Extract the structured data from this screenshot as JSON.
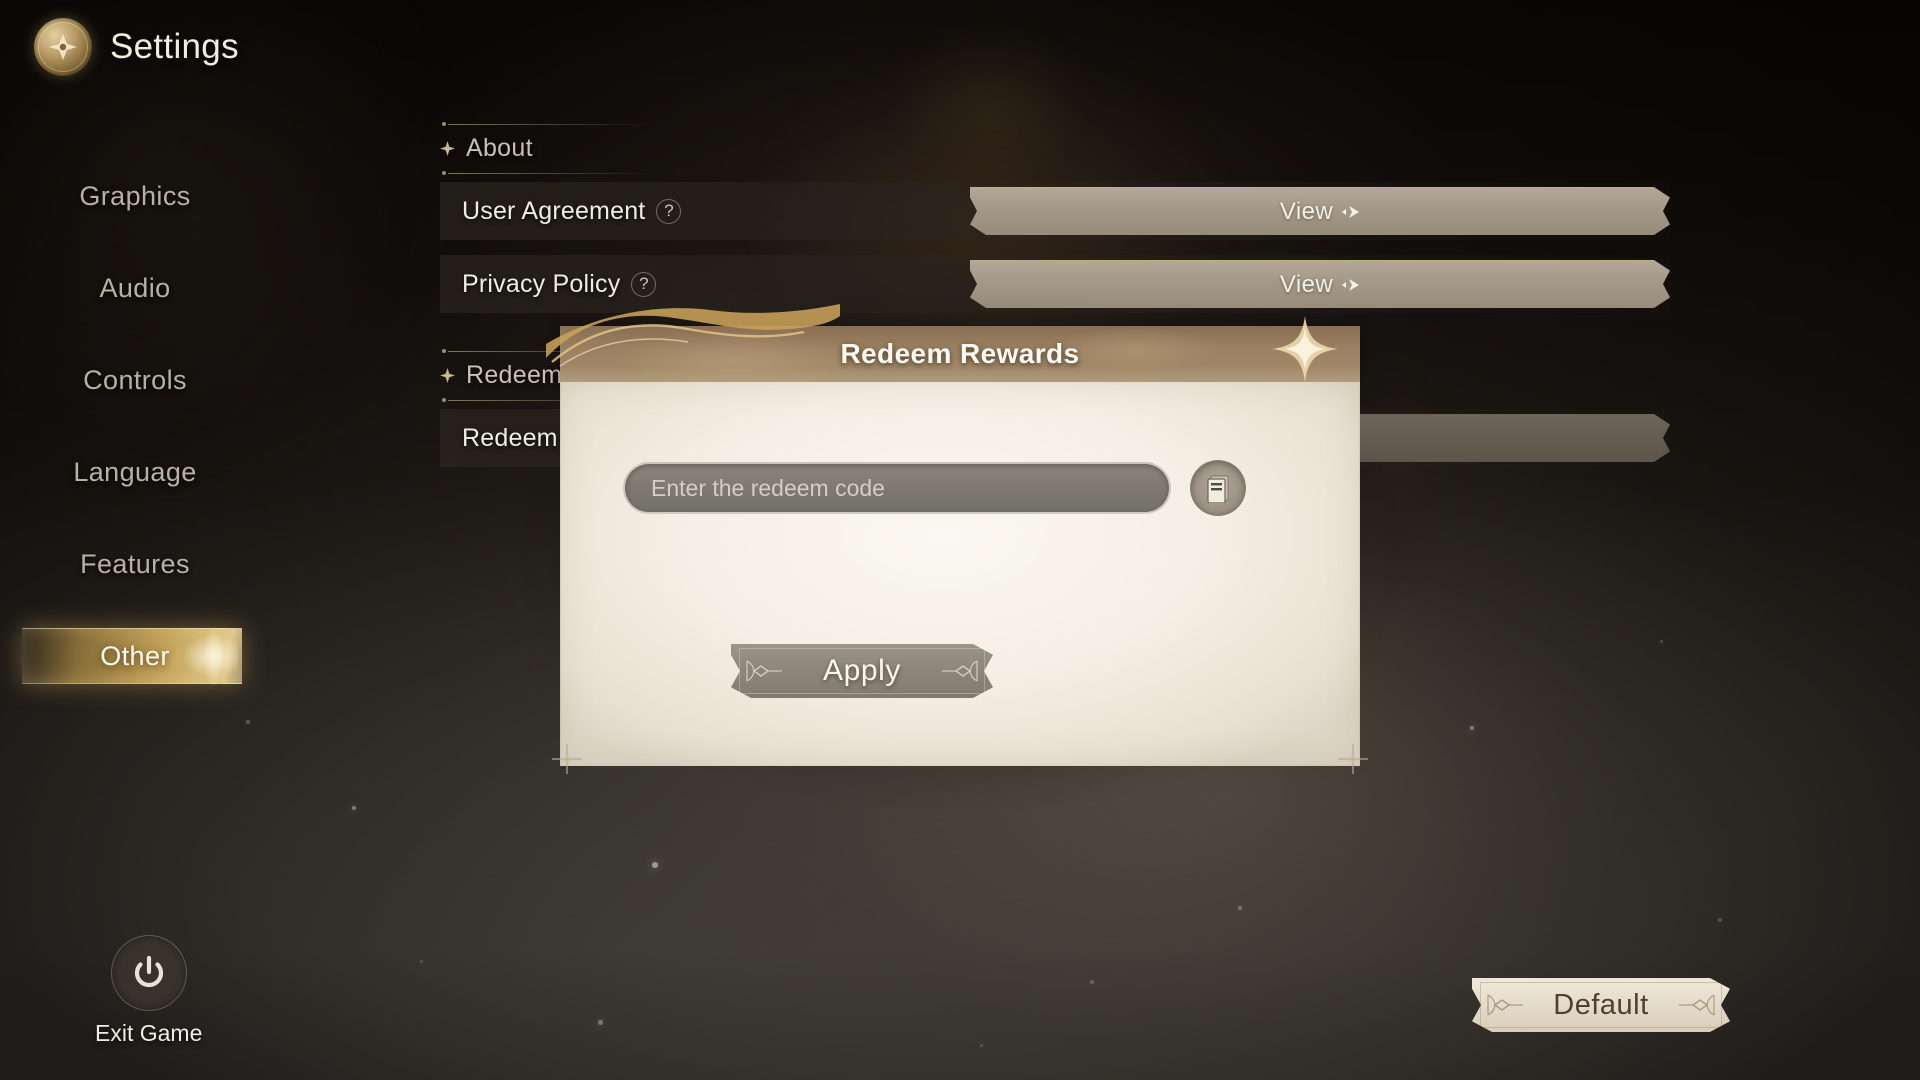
{
  "header": {
    "title": "Settings",
    "emblem_icon": "compass-emblem-icon"
  },
  "sidebar": {
    "items": [
      {
        "label": "Graphics",
        "active": false
      },
      {
        "label": "Audio",
        "active": false
      },
      {
        "label": "Controls",
        "active": false
      },
      {
        "label": "Language",
        "active": false
      },
      {
        "label": "Features",
        "active": false
      },
      {
        "label": "Other",
        "active": true
      }
    ],
    "exit": {
      "label": "Exit Game",
      "icon": "power-icon"
    }
  },
  "main": {
    "sections": [
      {
        "title": "About",
        "bullet_icon": "diamond-sparkle-icon",
        "rows": [
          {
            "label": "User Agreement",
            "help_icon": "question-mark-icon",
            "button_label": "View",
            "button_icon": "arrow-right-icon",
            "dim": false
          },
          {
            "label": "Privacy Policy",
            "help_icon": "question-mark-icon",
            "button_label": "View",
            "button_icon": "arrow-right-icon",
            "dim": false
          }
        ]
      },
      {
        "title": "Redeem Code",
        "bullet_icon": "diamond-sparkle-icon",
        "rows": [
          {
            "label": "Redeem Code",
            "help_icon": "",
            "button_label": "",
            "button_icon": "arrow-right-icon",
            "dim": true
          }
        ]
      }
    ]
  },
  "modal": {
    "title": "Redeem Rewards",
    "star_icon": "four-point-star-icon",
    "input": {
      "placeholder": "Enter the redeem code",
      "value": ""
    },
    "paste_button_icon": "clipboard-paste-icon",
    "apply_label": "Apply"
  },
  "footer": {
    "default_label": "Default"
  },
  "colors": {
    "gold_accent": "#d8b060",
    "plate_tan": "#a59a88",
    "modal_header": "#9b8062",
    "modal_body": "#f4efe4",
    "text_light": "#f0ece3",
    "text_dark": "#52402c"
  }
}
